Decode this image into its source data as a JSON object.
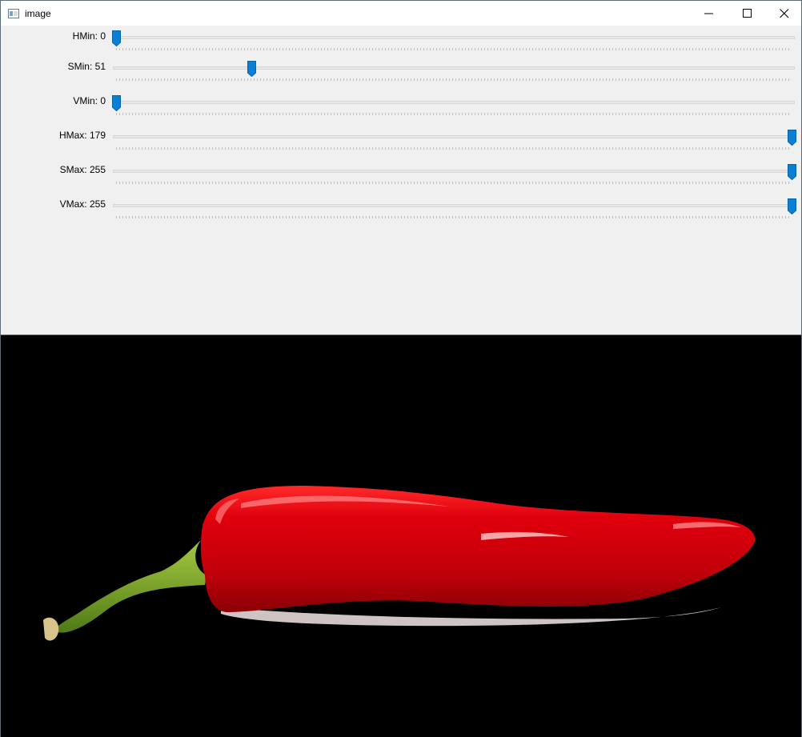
{
  "window": {
    "title": "image",
    "icon": "opencv-window-icon",
    "controls": [
      "minimize-icon",
      "maximize-icon",
      "close-icon"
    ]
  },
  "trackbars": [
    {
      "id": "hmin",
      "label": "HMin: 0",
      "value": 0,
      "max": 179
    },
    {
      "id": "smin",
      "label": "SMin: 51",
      "value": 51,
      "max": 255
    },
    {
      "id": "vmin",
      "label": "VMin: 0",
      "value": 0,
      "max": 255
    },
    {
      "id": "hmax",
      "label": "HMax: 179",
      "value": 179,
      "max": 179
    },
    {
      "id": "smax",
      "label": "SMax: 255",
      "value": 255,
      "max": 255
    },
    {
      "id": "vmax",
      "label": "VMax: 255",
      "value": 255,
      "max": 255
    }
  ],
  "colors": {
    "thumb": "#0a7fd4",
    "image_background": "#000000",
    "pepper_body": "#c4000a",
    "pepper_stem": "#6f9a1f"
  }
}
